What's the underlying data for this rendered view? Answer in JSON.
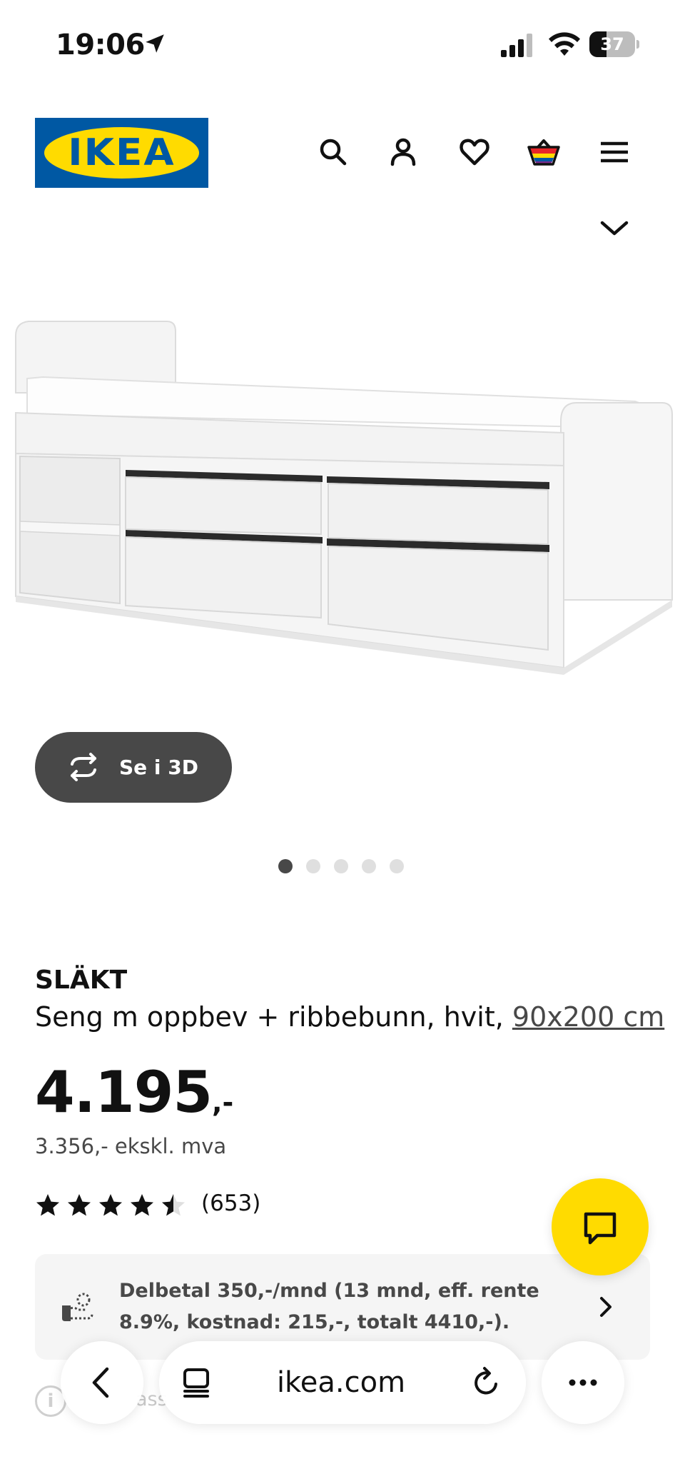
{
  "status_bar": {
    "time": "19:06",
    "battery_level": "37",
    "battery_fraction": 0.37
  },
  "header": {
    "logo_text": "IKEA",
    "icons": [
      "search-icon",
      "account-icon",
      "heart-icon",
      "basket-icon",
      "menu-icon",
      "chevron-down-icon"
    ]
  },
  "gallery": {
    "view_3d_label": "Se i 3D",
    "image_count": 5,
    "active_index": 0
  },
  "product": {
    "name": "SLÄKT",
    "description": "Seng m oppbev + ribbebunn, hvit, ",
    "size_link": "90x200 cm",
    "price_main": "4.195",
    "price_suffix": ",-",
    "price_ex_vat": "3.356,- ekskl. mva",
    "rating": 4.5,
    "rating_count": "(653)"
  },
  "finance": {
    "text": "Delbetal 350,-/mnd (13 mnd, eff. rente 8.9%, kostnad: 215,-, totalt 4410,-)."
  },
  "partial_text": "ass",
  "browser": {
    "url": "ikea.com"
  },
  "colors": {
    "brand_blue": "#0058a3",
    "brand_yellow": "#ffdb00",
    "button_dark": "#484848"
  }
}
